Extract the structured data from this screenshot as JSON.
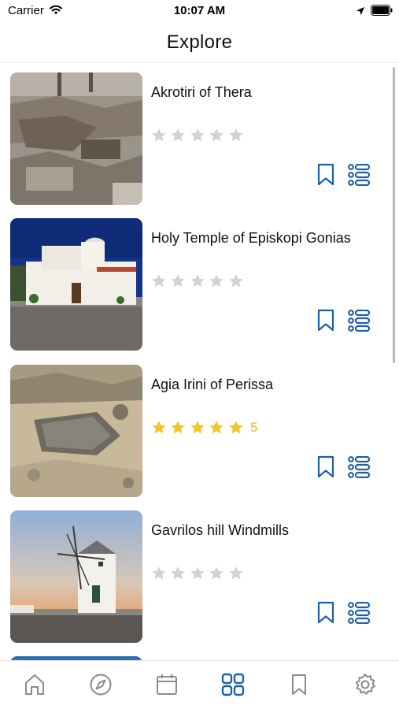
{
  "status_bar": {
    "carrier": "Carrier",
    "time": "10:07 AM"
  },
  "header": {
    "title": "Explore"
  },
  "places": [
    {
      "title": "Akrotiri of Thera",
      "rating": 0,
      "rating_label": ""
    },
    {
      "title": "Holy Temple of Episkopi Gonias",
      "rating": 0,
      "rating_label": ""
    },
    {
      "title": "Agia Irini of Perissa",
      "rating": 5,
      "rating_label": "5"
    },
    {
      "title": "Gavrilos hill Windmills",
      "rating": 0,
      "rating_label": ""
    }
  ],
  "tabs": [
    {
      "icon": "home-icon",
      "active": false
    },
    {
      "icon": "compass-icon",
      "active": false
    },
    {
      "icon": "calendar-icon",
      "active": false
    },
    {
      "icon": "grid-icon",
      "active": true
    },
    {
      "icon": "bookmark-icon",
      "active": false
    },
    {
      "icon": "gear-icon",
      "active": false
    }
  ],
  "colors": {
    "accent": "#1f5fa6",
    "star_filled": "#f2c52a",
    "star_empty": "#d2d2d2",
    "inactive_tab": "#8a8a8a"
  }
}
